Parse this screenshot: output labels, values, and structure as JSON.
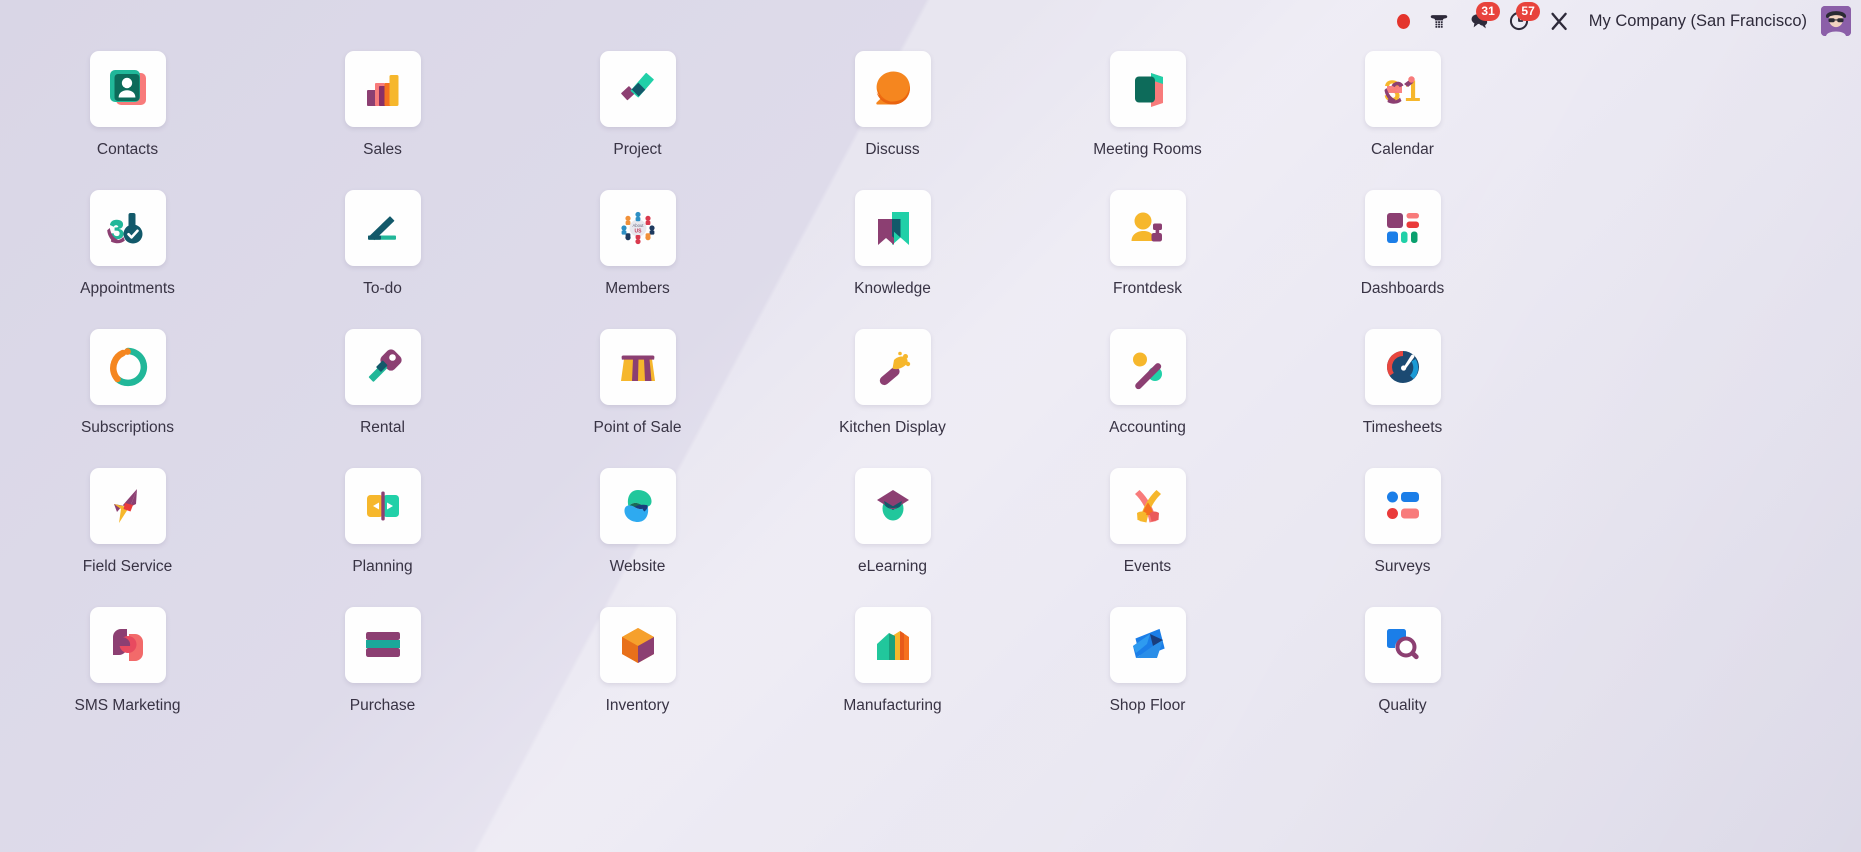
{
  "topbar": {
    "items": [
      {
        "name": "recording-indicator-icon",
        "icon": "record-dot",
        "badge": null,
        "label": ""
      },
      {
        "name": "voip-phone-icon",
        "icon": "phone",
        "badge": null,
        "label": ""
      },
      {
        "name": "messages-icon",
        "icon": "chat-bubbles",
        "badge": "31",
        "label": ""
      },
      {
        "name": "activities-icon",
        "icon": "clock",
        "badge": "57",
        "label": ""
      },
      {
        "name": "settings-tools-icon",
        "icon": "wrench-cross",
        "badge": null,
        "label": ""
      }
    ],
    "company": "My Company (San Francisco)",
    "avatar_alt": "user-avatar"
  },
  "apps": [
    {
      "label": "Contacts",
      "icon": "contacts"
    },
    {
      "label": "Sales",
      "icon": "sales"
    },
    {
      "label": "Project",
      "icon": "project"
    },
    {
      "label": "Discuss",
      "icon": "discuss"
    },
    {
      "label": "Meeting Rooms",
      "icon": "meeting-rooms"
    },
    {
      "label": "Calendar",
      "icon": "calendar"
    },
    {
      "label": "Appointments",
      "icon": "appointments"
    },
    {
      "label": "To-do",
      "icon": "todo"
    },
    {
      "label": "Members",
      "icon": "members"
    },
    {
      "label": "Knowledge",
      "icon": "knowledge"
    },
    {
      "label": "Frontdesk",
      "icon": "frontdesk"
    },
    {
      "label": "Dashboards",
      "icon": "dashboards"
    },
    {
      "label": "Subscriptions",
      "icon": "subscriptions"
    },
    {
      "label": "Rental",
      "icon": "rental"
    },
    {
      "label": "Point of Sale",
      "icon": "point-of-sale"
    },
    {
      "label": "Kitchen Display",
      "icon": "kitchen-display"
    },
    {
      "label": "Accounting",
      "icon": "accounting"
    },
    {
      "label": "Timesheets",
      "icon": "timesheets"
    },
    {
      "label": "Field Service",
      "icon": "field-service"
    },
    {
      "label": "Planning",
      "icon": "planning"
    },
    {
      "label": "Website",
      "icon": "website"
    },
    {
      "label": "eLearning",
      "icon": "elearning"
    },
    {
      "label": "Events",
      "icon": "events"
    },
    {
      "label": "Surveys",
      "icon": "surveys"
    },
    {
      "label": "SMS Marketing",
      "icon": "sms-marketing"
    },
    {
      "label": "Purchase",
      "icon": "purchase"
    },
    {
      "label": "Inventory",
      "icon": "inventory"
    },
    {
      "label": "Manufacturing",
      "icon": "manufacturing"
    },
    {
      "label": "Shop Floor",
      "icon": "shop-floor"
    },
    {
      "label": "Quality",
      "icon": "quality"
    }
  ],
  "colors": {
    "background": "#dedbea",
    "tile": "#fefefe",
    "badge": "#e8433c",
    "text": "#383344",
    "teal": "#21b799",
    "purple": "#8c3f72",
    "darkteal": "#12596a",
    "orange": "#f5861f",
    "yellow": "#f6b72c",
    "pink": "#f87b7b",
    "blue": "#1a7fd4",
    "navy": "#1c3f6e"
  },
  "calendar_day": "31"
}
